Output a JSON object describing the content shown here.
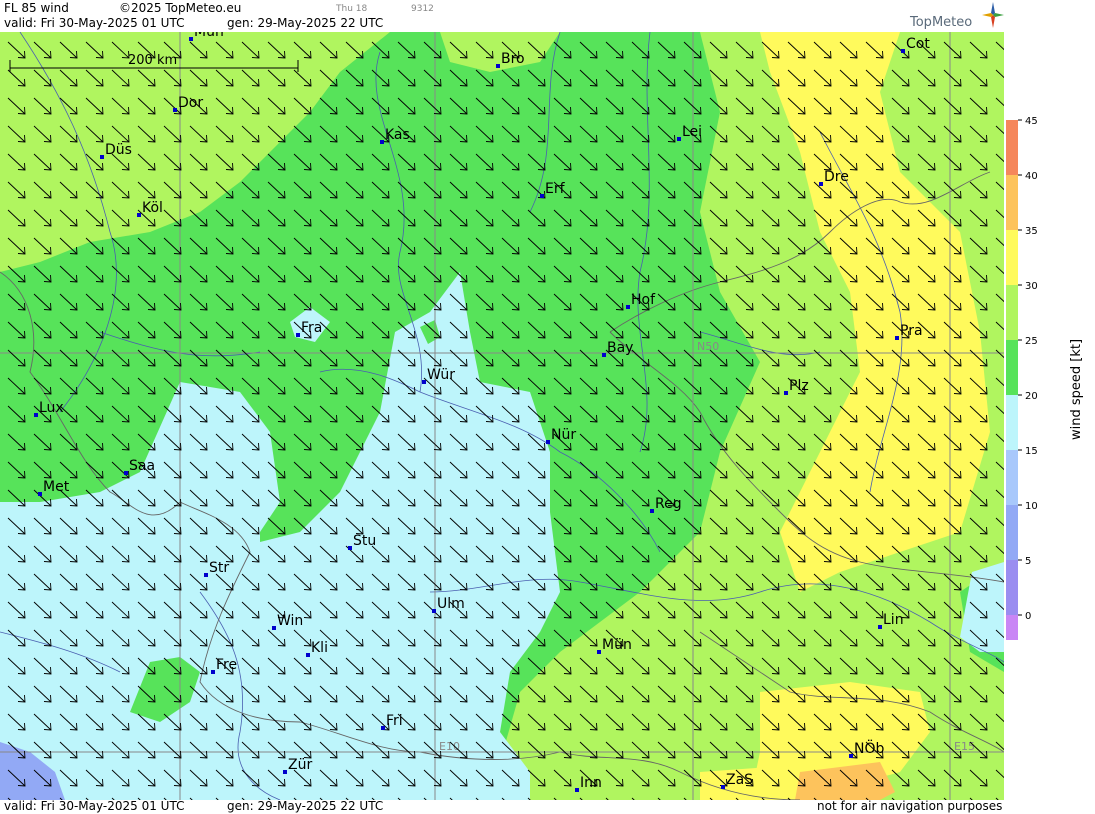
{
  "header": {
    "product": "FL 85 wind",
    "copyright": "©2025 TopMeteo.eu",
    "valid": "valid:  Fri  30-May-2025  01 UTC",
    "generated": "gen: 29-May-2025 22 UTC",
    "small_a": "Thu 18",
    "small_b": "9312",
    "brand": "TopMeteo"
  },
  "footer": {
    "valid": "valid:  Fri  30-May-2025  01 UTC",
    "generated": "gen: 29-May-2025 22 UTC",
    "disclaimer": "not for air navigation purposes"
  },
  "map": {
    "scale_label": "200 km",
    "grid_labels": [
      "N50",
      "E10",
      "E15"
    ],
    "cities": [
      {
        "id": "mun",
        "label": "Mün"
      },
      {
        "id": "bro",
        "label": "Bro"
      },
      {
        "id": "cot",
        "label": "Cot"
      },
      {
        "id": "dor",
        "label": "Dor"
      },
      {
        "id": "kas",
        "label": "Kas"
      },
      {
        "id": "lei",
        "label": "Lei"
      },
      {
        "id": "dus",
        "label": "Düs"
      },
      {
        "id": "dre",
        "label": "Dre"
      },
      {
        "id": "erf",
        "label": "Erf"
      },
      {
        "id": "kol",
        "label": "Köl"
      },
      {
        "id": "hof",
        "label": "Hof"
      },
      {
        "id": "fra",
        "label": "Fra"
      },
      {
        "id": "pra",
        "label": "Pra"
      },
      {
        "id": "bay",
        "label": "Bay"
      },
      {
        "id": "wur",
        "label": "Wür"
      },
      {
        "id": "plz",
        "label": "Plz"
      },
      {
        "id": "lux",
        "label": "Lux"
      },
      {
        "id": "nur",
        "label": "Nür"
      },
      {
        "id": "saa",
        "label": "Saa"
      },
      {
        "id": "met",
        "label": "Met"
      },
      {
        "id": "reg",
        "label": "Reg"
      },
      {
        "id": "stu",
        "label": "Stu"
      },
      {
        "id": "str",
        "label": "Str"
      },
      {
        "id": "ulm",
        "label": "Ulm"
      },
      {
        "id": "win",
        "label": "Win"
      },
      {
        "id": "lin",
        "label": "Lin"
      },
      {
        "id": "kli",
        "label": "Kli"
      },
      {
        "id": "munich",
        "label": "Mün"
      },
      {
        "id": "fre",
        "label": "Fre"
      },
      {
        "id": "fri",
        "label": "Fri"
      },
      {
        "id": "nob",
        "label": "NÖb"
      },
      {
        "id": "zur",
        "label": "Zür"
      },
      {
        "id": "inn",
        "label": "Inn"
      },
      {
        "id": "zas",
        "label": "ZaS"
      }
    ]
  },
  "legend": {
    "title": "wind speed [kt]",
    "ticks": [
      "0",
      "5",
      "10",
      "15",
      "20",
      "25",
      "30",
      "35",
      "40",
      "45"
    ],
    "colors": [
      "#c986f5",
      "#9a8df0",
      "#92a9f5",
      "#a8c8fb",
      "#bdf5fb",
      "#57e35a",
      "#b0f55f",
      "#fffa5c",
      "#fdc35c",
      "#f5875c"
    ]
  },
  "colors": {
    "band_15_20": "#bdf5fb",
    "band_20_25": "#57e35a",
    "band_25_30": "#b0f55f",
    "band_30_35": "#fffa5c",
    "band_35_40": "#fdc35c",
    "band_10_15": "#92a9f5",
    "city_marker": "#0000cc"
  }
}
